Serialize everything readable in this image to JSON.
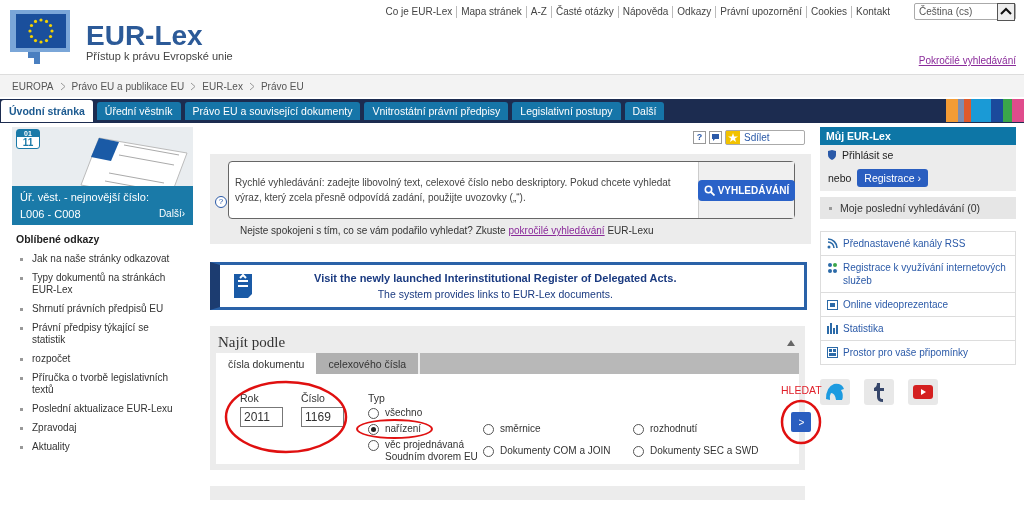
{
  "header": {
    "logo_text": "EUR-Lex",
    "tagline": "Přístup k právu Evropské unie",
    "top_links": [
      "Co je EUR-Lex",
      "Mapa stránek",
      "A-Z",
      "Časté otázky",
      "Nápověda",
      "Odkazy",
      "Právní upozornění",
      "Cookies",
      "Kontakt"
    ],
    "language": "Čeština (cs)",
    "advanced_link": "Pokročilé vyhledávání"
  },
  "breadcrumb": [
    "EUROPA",
    "Právo EU a publikace EU",
    "EUR-Lex",
    "Právo EU"
  ],
  "nav": [
    {
      "label": "Úvodní stránka",
      "selected": true
    },
    {
      "label": "Úřední věstník",
      "selected": false
    },
    {
      "label": "Právo EU a související dokumenty",
      "selected": false
    },
    {
      "label": "Vnitrostátní právní předpisy",
      "selected": false
    },
    {
      "label": "Legislativní postupy",
      "selected": false
    },
    {
      "label": "Další",
      "selected": false
    }
  ],
  "oj": {
    "title": "Úř. věst. - nejnovější číslo:",
    "issues": "L006 - C008",
    "more": "Další›",
    "month": "01",
    "day": "11"
  },
  "favorites": {
    "title": "Oblíbené odkazy",
    "items": [
      "Jak na naše stránky odkazovat",
      "Typy dokumentů na stránkách EUR-Lex",
      "Shrnutí právních předpisů EU",
      "Právní předpisy týkající se statistik",
      "rozpočet",
      "Příručka o tvorbě legislativních textů",
      "Poslední aktualizace EUR-Lexu",
      "Zpravodaj",
      "Aktuality"
    ]
  },
  "share": {
    "help": "?",
    "label": "Sdílet"
  },
  "quick_search": {
    "help": "?",
    "text": "Rychlé vyhledávání: zadejte libovolný text, celexové číslo nebo deskriptory. Pokud chcete vyhledat výraz, který zcela přesně odpovídá zadání, použijte uvozovky („“).",
    "button": "VYHLEDÁVÁNÍ",
    "hint_before": "Nejste spokojeni s tím, co se vám podařilo vyhledat? Zkuste",
    "hint_link": "pokročilé vyhledávání",
    "hint_after": "EUR-Lexu"
  },
  "banner": {
    "title": "Visit the newly launched Interinstitutional Register of Delegated Acts.",
    "subtitle": "The system provides links to EUR-Lex documents."
  },
  "find_by": {
    "title": "Najít podle",
    "expanded": true,
    "tabs": [
      {
        "label": "čísla dokumentu",
        "selected": true
      },
      {
        "label": "celexového čísla",
        "selected": false
      }
    ],
    "fields": [
      {
        "label": "Rok",
        "value": "2011"
      },
      {
        "label": "Číslo",
        "value": "1169"
      }
    ],
    "type_label": "Typ",
    "types": [
      {
        "label": "všechno",
        "selected": false
      },
      {
        "label": "nařízení",
        "selected": true
      },
      {
        "label": "směrnice",
        "selected": false
      },
      {
        "label": "rozhodnutí",
        "selected": false
      },
      {
        "label": "věc projednávaná Soudním dvorem EU",
        "selected": false
      },
      {
        "label": "Dokumenty COM a JOIN",
        "selected": false
      },
      {
        "label": "Dokumenty SEC a SWD",
        "selected": false
      }
    ],
    "submit": ">",
    "submit_caption": "HLEDAT"
  },
  "my_eurlex": {
    "title": "Můj EUR-Lex",
    "login": "Přihlásit se",
    "or": "nebo",
    "register": "Registrace ›",
    "recent": "Moje poslední vyhledávání (0)"
  },
  "services": [
    {
      "kind": "rss",
      "label": "Přednastavené kanály RSS"
    },
    {
      "kind": "people",
      "label": "Registrace k využívání internetových služeb"
    },
    {
      "kind": "video",
      "label": "Online videoprezentace"
    },
    {
      "kind": "stats",
      "label": "Statistika"
    },
    {
      "kind": "comments",
      "label": "Prostor pro vaše připomínky"
    }
  ],
  "social": [
    {
      "kind": "bird"
    },
    {
      "kind": "tumblr"
    },
    {
      "kind": "youtube"
    }
  ]
}
